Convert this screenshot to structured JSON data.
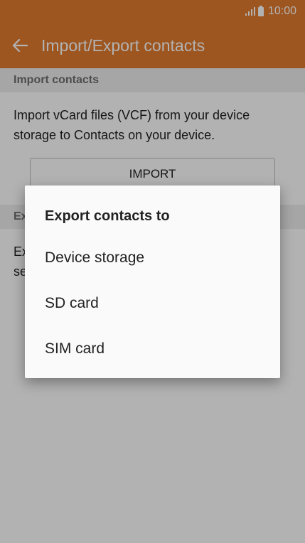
{
  "status_bar": {
    "time": "10:00",
    "icons": [
      "signal-icon",
      "battery-icon"
    ]
  },
  "app_bar": {
    "title": "Import/Export contacts",
    "back_icon": "back-arrow-icon"
  },
  "import_section": {
    "header": "Import contacts",
    "description": "Import vCard files (VCF) from your device storage to Contacts on your device.",
    "button_label": "IMPORT"
  },
  "export_section": {
    "header_partial": "Ex",
    "description_partial_line1": "Ex",
    "description_partial_line2": "se"
  },
  "dialog": {
    "title": "Export contacts to",
    "options": [
      "Device storage",
      "SD card",
      "SIM card"
    ]
  },
  "colors": {
    "accent": "#e37c2f",
    "section_bg": "#eeeeee",
    "dialog_bg": "#fafafa"
  }
}
